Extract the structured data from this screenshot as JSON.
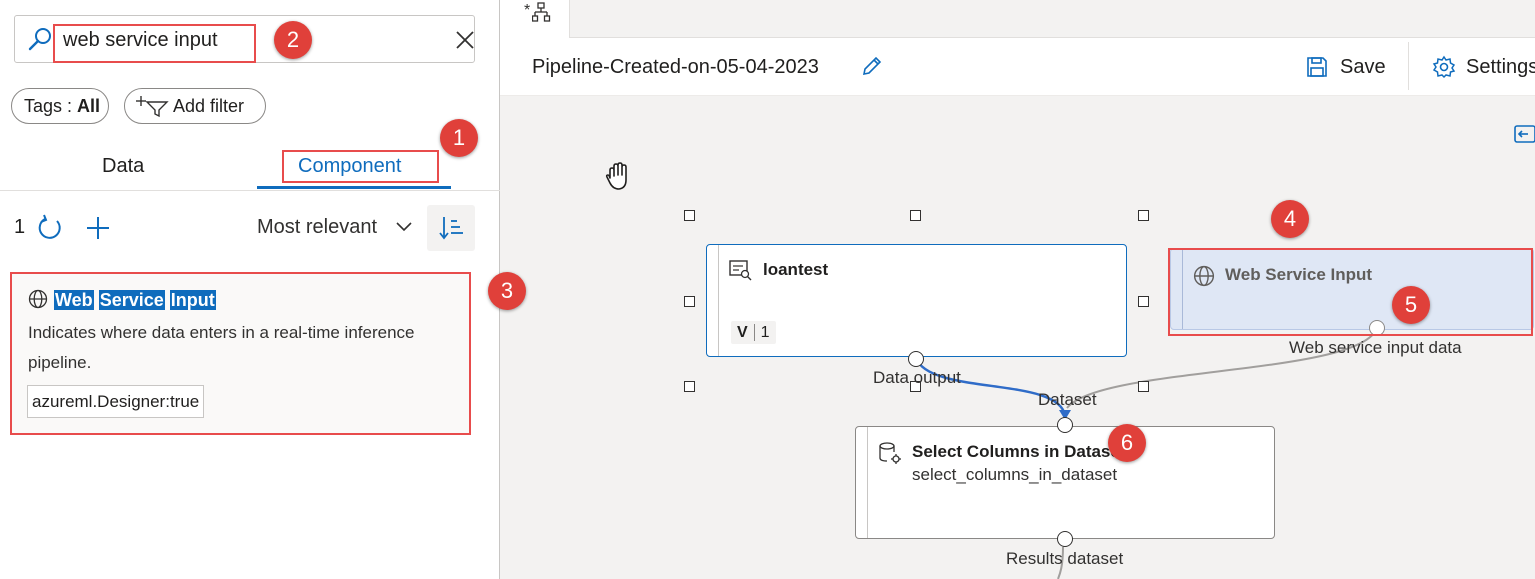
{
  "left_panel": {
    "search": {
      "value": "web service input",
      "placeholder": ""
    },
    "filters": {
      "tags_label": "Tags : ",
      "tags_value": "All",
      "add_filter": "Add filter"
    },
    "tabs": [
      {
        "label": "Data"
      },
      {
        "label": "Component",
        "selected": true
      }
    ],
    "results": {
      "count": "1",
      "sort_label": "Most relevant"
    },
    "result_card": {
      "title_words": [
        "Web",
        "Service",
        "Input"
      ],
      "description": "Indicates where data enters in a real-time inference pipeline.",
      "tag": "azureml.Designer:true"
    }
  },
  "header": {
    "tab_modified_marker": "*",
    "pipeline_title": "Pipeline-Created-on-05-04-2023",
    "save_label": "Save",
    "settings_label": "Settings"
  },
  "canvas": {
    "nodes": {
      "loantest": {
        "title": "loantest",
        "version_label": "V",
        "version": "1",
        "output_port": "Data output"
      },
      "web_service_input": {
        "title": "Web Service Input",
        "output_port": "Web service input data"
      },
      "select_columns": {
        "title": "Select Columns in Dataset",
        "subtitle": "select_columns_in_dataset",
        "input_port": "Dataset",
        "output_port": "Results dataset"
      }
    }
  },
  "annotations": [
    "1",
    "2",
    "3",
    "4",
    "5",
    "6"
  ],
  "colors": {
    "accent": "#0f6cbd",
    "annotation": "#e0403a",
    "canvas_bg": "#f3f2f1",
    "node_selected_bg": "#dfe7f5"
  }
}
